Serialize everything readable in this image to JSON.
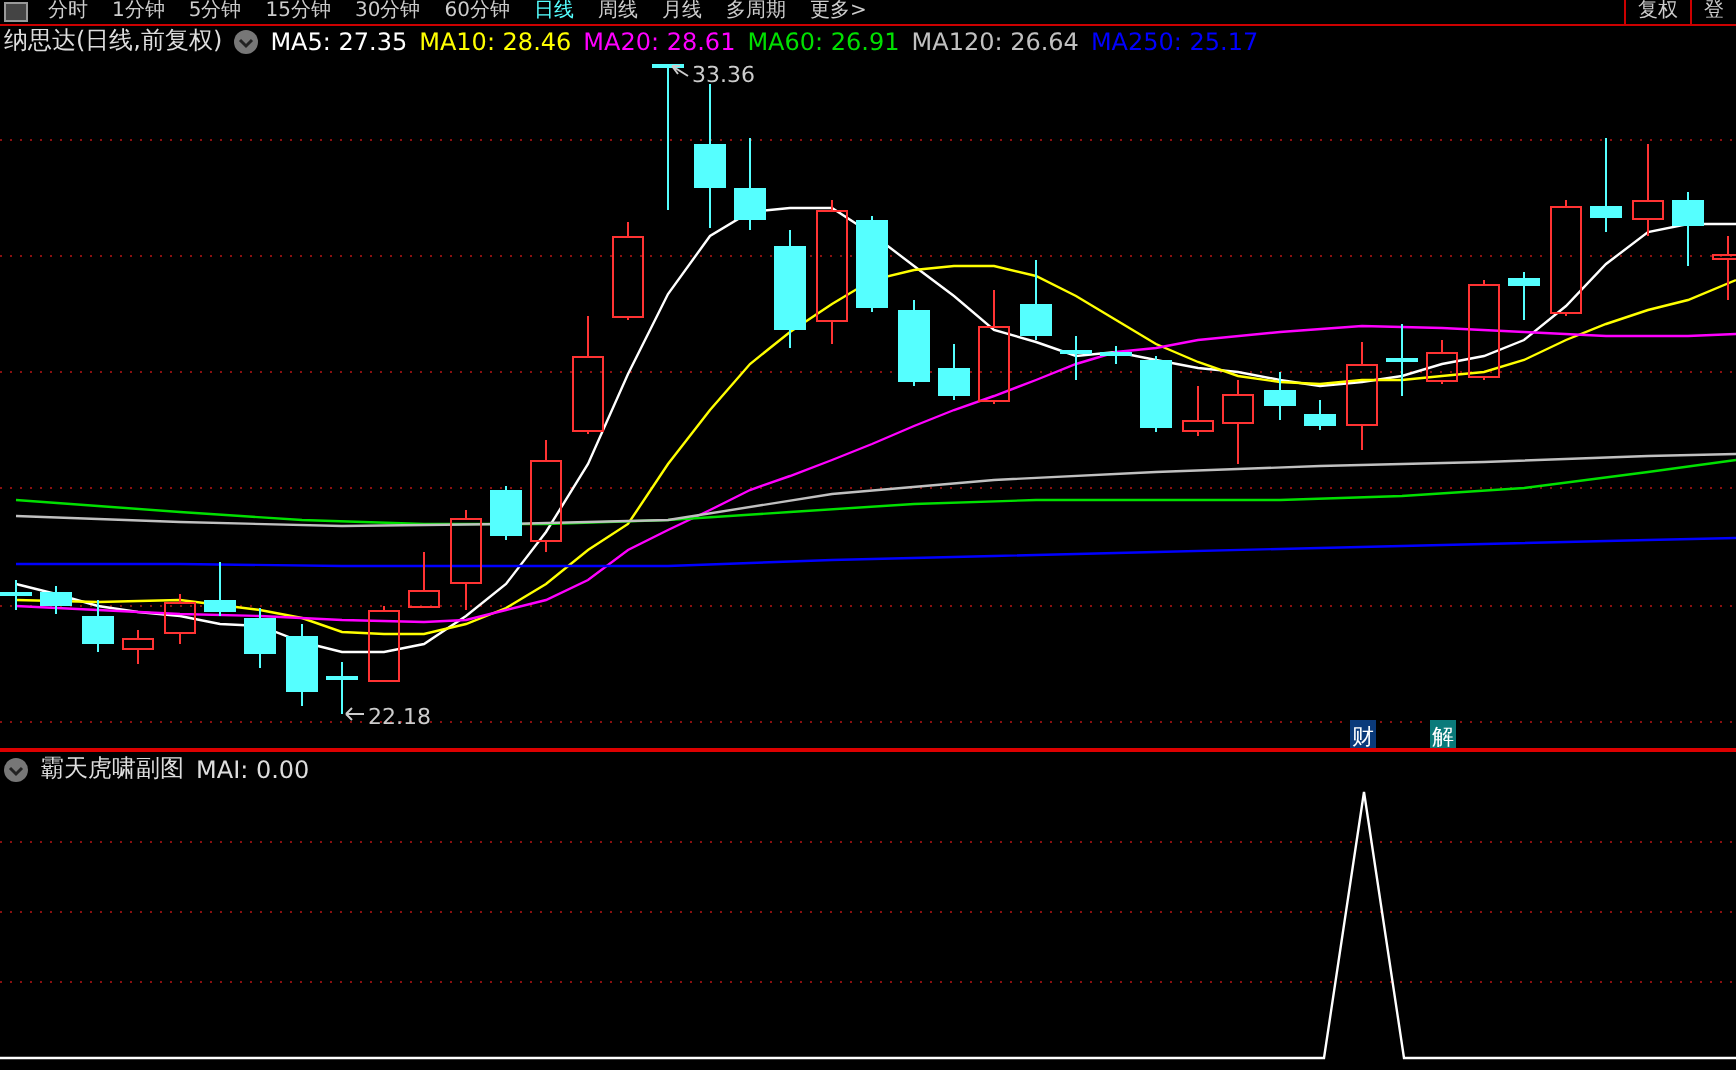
{
  "toolbar": {
    "tabs": [
      {
        "label": "分时",
        "selected": false
      },
      {
        "label": "1分钟",
        "selected": false
      },
      {
        "label": "5分钟",
        "selected": false
      },
      {
        "label": "15分钟",
        "selected": false
      },
      {
        "label": "30分钟",
        "selected": false
      },
      {
        "label": "60分钟",
        "selected": false
      },
      {
        "label": "日线",
        "selected": true
      },
      {
        "label": "周线",
        "selected": false
      },
      {
        "label": "月线",
        "selected": false
      },
      {
        "label": "多周期",
        "selected": false
      },
      {
        "label": "更多>",
        "selected": false
      }
    ],
    "buttons": [
      "复权",
      "登"
    ]
  },
  "main_chart": {
    "title": "纳思达(日线,前复权)",
    "indicators": [
      {
        "name": "MA5:",
        "value": "27.35",
        "color": "#ffffff"
      },
      {
        "name": "MA10:",
        "value": "28.46",
        "color": "#ffff00"
      },
      {
        "name": "MA20:",
        "value": "28.61",
        "color": "#ff00ff"
      },
      {
        "name": "MA60:",
        "value": "26.91",
        "color": "#00e000"
      },
      {
        "name": "MA120:",
        "value": "26.64",
        "color": "#c0c0c0"
      },
      {
        "name": "MA250:",
        "value": "25.17",
        "color": "#0000ff"
      }
    ],
    "high_label": "33.36",
    "low_label": "22.18",
    "markers": [
      {
        "label": "财",
        "color": "#0a3a7a"
      },
      {
        "label": "解",
        "color": "#0a7a7a"
      }
    ]
  },
  "sub_chart": {
    "title": "霸天虎啸副图",
    "indicator": "MAI: 0.00"
  }
}
